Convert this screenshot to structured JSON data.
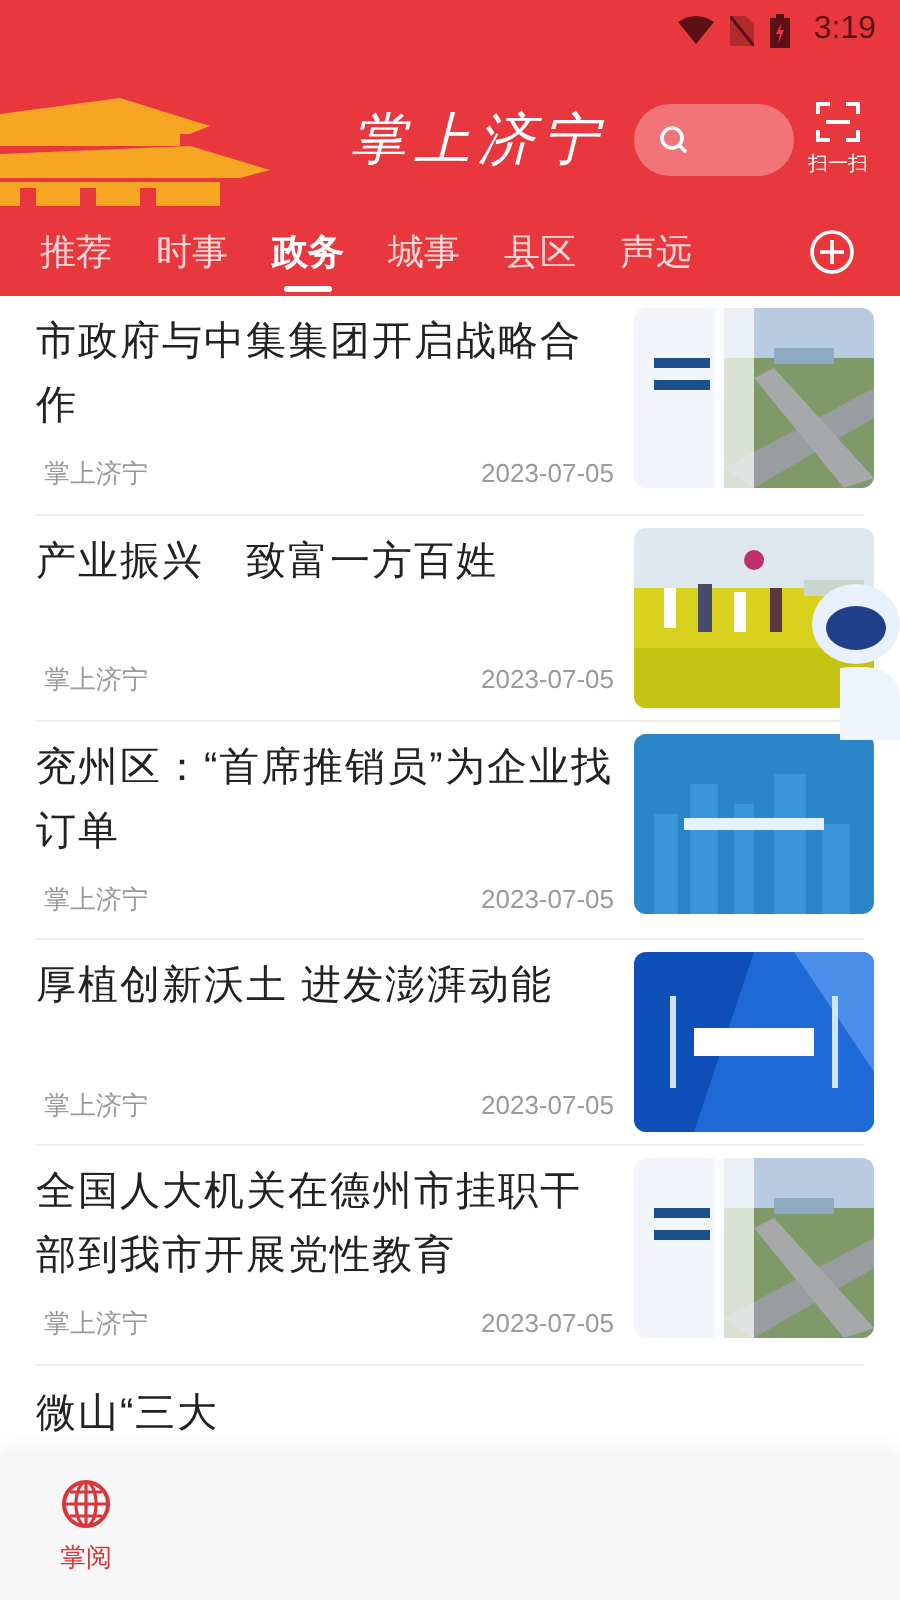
{
  "status_bar": {
    "time": "3:19"
  },
  "header": {
    "logo": "掌上济宁",
    "scan_label": "扫一扫"
  },
  "tabs": [
    {
      "label": "推荐",
      "selected": false
    },
    {
      "label": "时事",
      "selected": false
    },
    {
      "label": "政务",
      "selected": true
    },
    {
      "label": "城事",
      "selected": false
    },
    {
      "label": "县区",
      "selected": false
    },
    {
      "label": "声远",
      "selected": false
    }
  ],
  "articles": [
    {
      "title": "市政府与中集集团开启战略合作",
      "source": "掌上济宁",
      "date": "2023-07-05"
    },
    {
      "title": "产业振兴　致富一方百姓",
      "source": "掌上济宁",
      "date": "2023-07-05"
    },
    {
      "title": "兖州区：“首席推销员”为企业找订单",
      "source": "掌上济宁",
      "date": "2023-07-05"
    },
    {
      "title": "厚植创新沃土  进发澎湃动能",
      "source": "掌上济宁",
      "date": "2023-07-05"
    },
    {
      "title": "全国人大机关在德州市挂职干部到我市开展党性教育",
      "source": "掌上济宁",
      "date": "2023-07-05"
    },
    {
      "title": "微山“三大"
    }
  ],
  "bottom_nav": [
    {
      "label": "掌阅",
      "selected": true
    }
  ]
}
